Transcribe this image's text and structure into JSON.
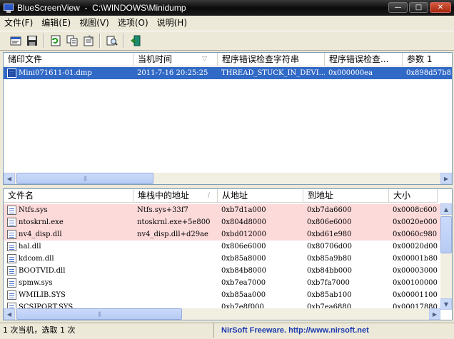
{
  "window": {
    "title": "BlueScreenView  -  C:\\WINDOWS\\Minidump",
    "minimize": "—",
    "maximize": "□",
    "close": "✕"
  },
  "menu": [
    {
      "label": "文件(F)"
    },
    {
      "label": "编辑(E)"
    },
    {
      "label": "视图(V)"
    },
    {
      "label": "选项(O)"
    },
    {
      "label": "说明(H)"
    }
  ],
  "toolbar": [
    {
      "icon": "open-folder-icon"
    },
    {
      "icon": "save-icon"
    },
    {
      "icon": "refresh-icon"
    },
    {
      "icon": "copy-icon"
    },
    {
      "icon": "properties-icon"
    },
    {
      "icon": "find-icon"
    },
    {
      "icon": "exit-icon"
    }
  ],
  "dump_list": {
    "columns": [
      "储印文件",
      "当机时间",
      "程序错误检查字符串",
      "程序错误检查...",
      "参数 1"
    ],
    "rows": [
      {
        "file": "Mini071611-01.dmp",
        "time": "2011-7-16 20:25:25",
        "bug_string": "THREAD_STUCK_IN_DEVI...",
        "bug_code": "0x000000ea",
        "param1": "0x898d57b8"
      }
    ]
  },
  "driver_list": {
    "columns": [
      "文件名",
      "堆栈中的地址",
      "从地址",
      "到地址",
      "大小"
    ],
    "rows": [
      {
        "name": "Ntfs.sys",
        "stack_addr": "Ntfs.sys+33f7",
        "from": "0xb7d1a000",
        "to": "0xb7da6600",
        "size": "0x0008c600",
        "highlight": true
      },
      {
        "name": "ntoskrnl.exe",
        "stack_addr": "ntoskrnl.exe+5e800",
        "from": "0x804d8000",
        "to": "0x806e6000",
        "size": "0x0020e000",
        "highlight": true
      },
      {
        "name": "nv4_disp.dll",
        "stack_addr": "nv4_disp.dll+d29ae",
        "from": "0xbd012000",
        "to": "0xbd61e980",
        "size": "0x0060c980",
        "highlight": true
      },
      {
        "name": "hal.dll",
        "stack_addr": "",
        "from": "0x806e6000",
        "to": "0x80706d00",
        "size": "0x00020d00",
        "highlight": false
      },
      {
        "name": "kdcom.dll",
        "stack_addr": "",
        "from": "0xb85a8000",
        "to": "0xb85a9b80",
        "size": "0x00001b80",
        "highlight": false
      },
      {
        "name": "BOOTVID.dll",
        "stack_addr": "",
        "from": "0xb84b8000",
        "to": "0xb84bb000",
        "size": "0x00003000",
        "highlight": false
      },
      {
        "name": "spmw.sys",
        "stack_addr": "",
        "from": "0xb7ea7000",
        "to": "0xb7fa7000",
        "size": "0x00100000",
        "highlight": false
      },
      {
        "name": "WMILIB.SYS",
        "stack_addr": "",
        "from": "0xb85aa000",
        "to": "0xb85ab100",
        "size": "0x00001100",
        "highlight": false
      },
      {
        "name": "SCSIPORT.SYS",
        "stack_addr": "",
        "from": "0xb7e8f000",
        "to": "0xb7ea6880",
        "size": "0x00017880",
        "highlight": false
      }
    ]
  },
  "status": {
    "summary": "1 次当机，选取 1 次",
    "credit": "NirSoft Freeware.  http://www.nirsoft.net"
  },
  "colors": {
    "selection": "#3169c6",
    "highlight_row": "#fddada",
    "link": "#1d3bb0"
  }
}
